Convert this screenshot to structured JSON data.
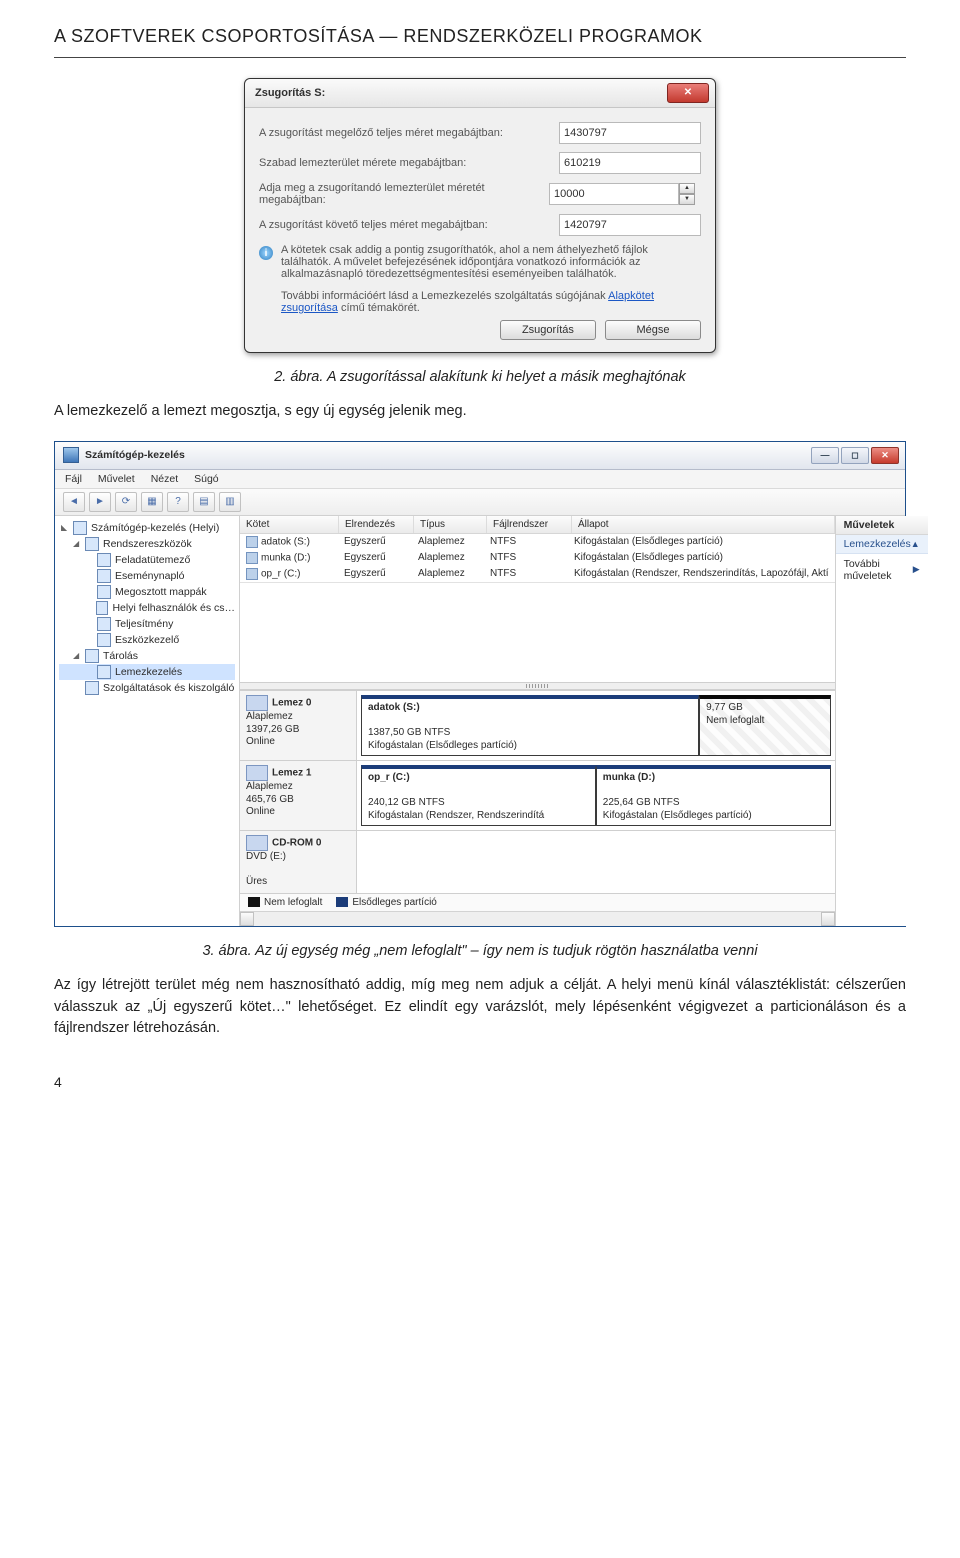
{
  "heading": "A SZOFTVEREK CSOPORTOSÍTÁSA — RENDSZERKÖZELI PROGRAMOK",
  "caption1": "2. ábra. A zsugorítással alakítunk ki helyet a másik meghajtónak",
  "para1": "A lemezkezelő a lemezt megosztja, s egy új egység jelenik meg.",
  "caption2": "3. ábra. Az új egység még „nem lefoglalt\" – így nem is tudjuk rögtön használatba venni",
  "para2": "Az így létrejött terület még nem hasznosítható addig, míg meg nem adjuk a célját. A helyi menü kínál választéklistát: célszerűen válasszuk az „Új egyszerű kötet…\" lehetőséget. Ez elindít egy varázslót, mely lépésenként végigvezet a particionáláson és a fájlrendszer létrehozásán.",
  "page_number": "4",
  "dlg": {
    "title": "Zsugorítás S:",
    "rows": [
      {
        "label": "A zsugorítást megelőző teljes méret megabájtban:",
        "value": "1430797"
      },
      {
        "label": "Szabad lemezterület mérete megabájtban:",
        "value": "610219"
      },
      {
        "label": "Adja meg a zsugorítandó lemezterület méretét megabájtban:",
        "value": "10000"
      },
      {
        "label": "A zsugorítást követő teljes méret megabájtban:",
        "value": "1420797"
      }
    ],
    "info1": "A kötetek csak addig a pontig zsugoríthatók, ahol a nem áthelyezhető fájlok találhatók. A művelet befejezésének időpontjára vonatkozó információk az alkalmazásnapló töredezettségmentesítési eseményeiben találhatók.",
    "info2a": "További információért lásd a Lemezkezelés szolgáltatás súgójának ",
    "info2_link": "Alapkötet zsugorítása",
    "info2b": " című témakörét.",
    "btn_ok": "Zsugorítás",
    "btn_cancel": "Mégse"
  },
  "mmc": {
    "title": "Számítógép-kezelés",
    "menu": [
      "Fájl",
      "Művelet",
      "Nézet",
      "Súgó"
    ],
    "tree": [
      {
        "lvl": 0,
        "caret": "◣",
        "label": "Számítógép-kezelés (Helyi)"
      },
      {
        "lvl": 1,
        "caret": "◢",
        "label": "Rendszereszközök"
      },
      {
        "lvl": 2,
        "caret": "",
        "label": "Feladatütemező"
      },
      {
        "lvl": 2,
        "caret": "",
        "label": "Eseménynapló"
      },
      {
        "lvl": 2,
        "caret": "",
        "label": "Megosztott mappák"
      },
      {
        "lvl": 2,
        "caret": "",
        "label": "Helyi felhasználók és cs…"
      },
      {
        "lvl": 2,
        "caret": "",
        "label": "Teljesítmény"
      },
      {
        "lvl": 2,
        "caret": "",
        "label": "Eszközkezelő"
      },
      {
        "lvl": 1,
        "caret": "◢",
        "label": "Tárolás"
      },
      {
        "lvl": 2,
        "caret": "",
        "label": "Lemezkezelés",
        "selected": true
      },
      {
        "lvl": 1,
        "caret": "",
        "label": "Szolgáltatások és kiszolgáló"
      }
    ],
    "vol_headers": [
      "Kötet",
      "Elrendezés",
      "Típus",
      "Fájlrendszer",
      "Állapot"
    ],
    "vol_rows": [
      {
        "name": "adatok (S:)",
        "layout": "Egyszerű",
        "type": "Alaplemez",
        "fs": "NTFS",
        "status": "Kifogástalan (Elsődleges partíció)"
      },
      {
        "name": "munka (D:)",
        "layout": "Egyszerű",
        "type": "Alaplemez",
        "fs": "NTFS",
        "status": "Kifogástalan (Elsődleges partíció)"
      },
      {
        "name": "op_r (C:)",
        "layout": "Egyszerű",
        "type": "Alaplemez",
        "fs": "NTFS",
        "status": "Kifogástalan (Rendszer, Rendszerindítás, Lapozófájl, Aktí"
      }
    ],
    "disks": [
      {
        "title": "Lemez 0",
        "type": "Alaplemez",
        "size": "1397,26 GB",
        "state": "Online",
        "parts": [
          {
            "name": "adatok (S:)",
            "size": "1387,50 GB NTFS",
            "status": "Kifogástalan (Elsődleges partíció)",
            "cls": "part-primary",
            "w": "72%"
          },
          {
            "name": "",
            "size": "9,77 GB",
            "status": "Nem lefoglalt",
            "cls": "part-unalloc",
            "w": "28%"
          }
        ]
      },
      {
        "title": "Lemez 1",
        "type": "Alaplemez",
        "size": "465,76 GB",
        "state": "Online",
        "parts": [
          {
            "name": "op_r (C:)",
            "size": "240,12 GB NTFS",
            "status": "Kifogástalan (Rendszer, Rendszerindítá",
            "cls": "part-primary",
            "w": "50%"
          },
          {
            "name": "munka (D:)",
            "size": "225,64 GB NTFS",
            "status": "Kifogástalan (Elsődleges partíció)",
            "cls": "part-primary",
            "w": "50%"
          }
        ]
      }
    ],
    "rom": {
      "title": "CD-ROM 0",
      "type": "DVD (E:)",
      "state": "Üres"
    },
    "legend": [
      {
        "label": "Nem lefoglalt",
        "cls": "leg-black"
      },
      {
        "label": "Elsődleges partíció",
        "cls": "leg-blue"
      }
    ],
    "actions": {
      "h1": "Műveletek",
      "h2": "Lemezkezelés",
      "item": "További műveletek"
    }
  }
}
